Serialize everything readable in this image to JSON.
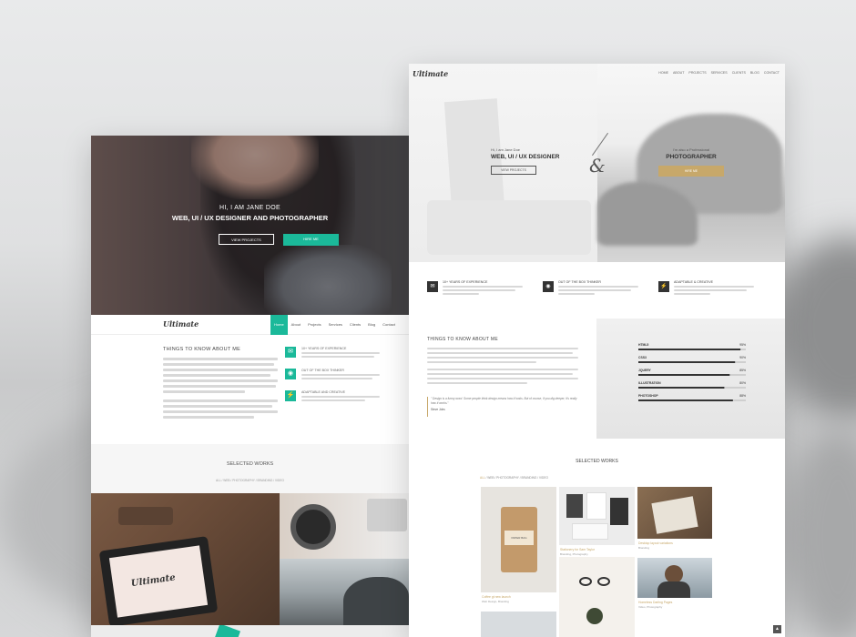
{
  "colors": {
    "accent_green": "#1bb99a",
    "accent_gold": "#c7a86a",
    "dark": "#333333"
  },
  "left": {
    "hero": {
      "greeting": "HI, I AM JANE DOE",
      "title": "WEB, UI / UX DESIGNER AND PHOTOGRAPHER",
      "btn_projects": "VIEW PROJECTS",
      "btn_hire": "HIRE ME"
    },
    "logo": "Ultimate",
    "nav": [
      "Home",
      "About",
      "Projects",
      "Services",
      "Clients",
      "Blog",
      "Contact"
    ],
    "about": {
      "title": "THINGS TO KNOW ABOUT ME"
    },
    "features": [
      {
        "icon": "megaphone-icon",
        "label": "10+ YEARS OF EXPERIENCE"
      },
      {
        "icon": "lightbulb-icon",
        "label": "OUT OF THE BOX THINKER"
      },
      {
        "icon": "bolt-icon",
        "label": "ADAPTABLE AND CREATIVE"
      }
    ],
    "works": {
      "title": "SELECTED WORKS",
      "filters": [
        "ALL",
        "WEB",
        "PHOTOGRAPHY",
        "BRANDING",
        "VIDEO"
      ]
    },
    "tile_logo": "Ultimate"
  },
  "right": {
    "logo": "Ultimate",
    "nav": [
      "HOME",
      "ABOUT",
      "PROJECTS",
      "SERVICES",
      "CLIENTS",
      "BLOG",
      "CONTACT"
    ],
    "hero": {
      "left_small": "Hi, I am Jane Doe",
      "left_title": "WEB, UI / UX DESIGNER",
      "left_btn": "VIEW PROJECTS",
      "amp": "&",
      "right_small": "I'm also a Professional",
      "right_title": "PHOTOGRAPHER",
      "right_btn": "HIRE ME"
    },
    "features": [
      {
        "icon": "megaphone-icon",
        "label": "10+ YEARS OF EXPERIENCE"
      },
      {
        "icon": "lightbulb-icon",
        "label": "OUT OF THE BOX THINKER"
      },
      {
        "icon": "bolt-icon",
        "label": "ADAPTABLE & CREATIVE"
      }
    ],
    "about": {
      "title": "THINGS TO KNOW ABOUT ME",
      "quote": "\" Design is a funny word. Some people think design means how it looks. But of course, if you dig deeper, it's really how it works.\"",
      "quote_author": "Steve Jobs"
    },
    "skills": [
      {
        "name": "HTML5",
        "value": "95%",
        "level": 0.95
      },
      {
        "name": "CSS3",
        "value": "90%",
        "level": 0.9
      },
      {
        "name": "JQUERY",
        "value": "85%",
        "level": 0.85
      },
      {
        "name": "ILLUSTRATION",
        "value": "80%",
        "level": 0.8
      },
      {
        "name": "PHOTOSHOP",
        "value": "88%",
        "level": 0.88
      }
    ],
    "works": {
      "title": "SELECTED WORKS",
      "filters": [
        "ALL",
        "WEB",
        "PHOTOGRAPHY",
        "BRANDING",
        "VIDEO"
      ],
      "items": [
        {
          "title": "Coffee gt new launch",
          "tags": "Web Design, Branding",
          "brand": "PAPER BAG"
        },
        {
          "title": "Stationery for Sam Taylor",
          "tags": "Branding, Photography"
        },
        {
          "title": "Desktop layout variations",
          "tags": "Branding"
        },
        {
          "title": "Homeless Darling Pages",
          "tags": "Video, Photography"
        }
      ]
    }
  }
}
